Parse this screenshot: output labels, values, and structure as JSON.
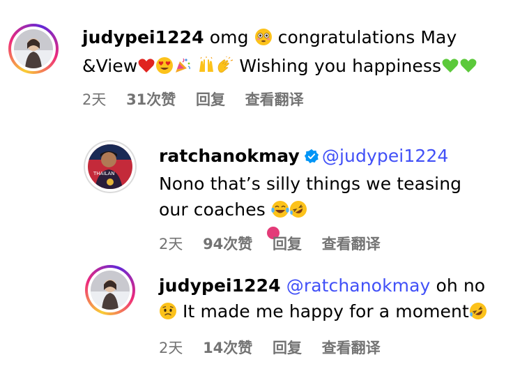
{
  "comments": [
    {
      "username": "judypei1224",
      "text_a": "omg ",
      "text_b": " congratulations May",
      "text_c": "&View",
      "text_d": " Wishing you happiness",
      "time": "2天",
      "likes": "31次赞",
      "reply": "回复",
      "translate": "查看翻译"
    },
    {
      "username": "ratchanokmay",
      "mention": "@judypei1224",
      "text_a": "Nono that’s silly things we teasing",
      "text_b": "our coaches ",
      "time": "2天",
      "likes": "94次赞",
      "reply": "回复",
      "translate": "查看翻译",
      "verified": true
    },
    {
      "username": "judypei1224",
      "mention": "@ratchanokmay",
      "text_a": " oh no",
      "text_b": " It made me happy for a moment",
      "time": "2天",
      "likes": "14次赞",
      "reply": "回复",
      "translate": "查看翻译"
    }
  ],
  "colors": {
    "mention": "#4150f7",
    "meta": "#737373",
    "verified": "#0095f6",
    "pink_dot": "#e33b78"
  },
  "icons": [
    "flushed-emoji",
    "red-heart-emoji",
    "heart-eyes-emoji",
    "party-popper-emoji",
    "raising-hands-emoji",
    "clapping-hands-emoji",
    "green-heart-emoji",
    "tears-of-joy-emoji",
    "rolling-laughing-emoji",
    "worried-emoji",
    "verified-badge-icon"
  ]
}
